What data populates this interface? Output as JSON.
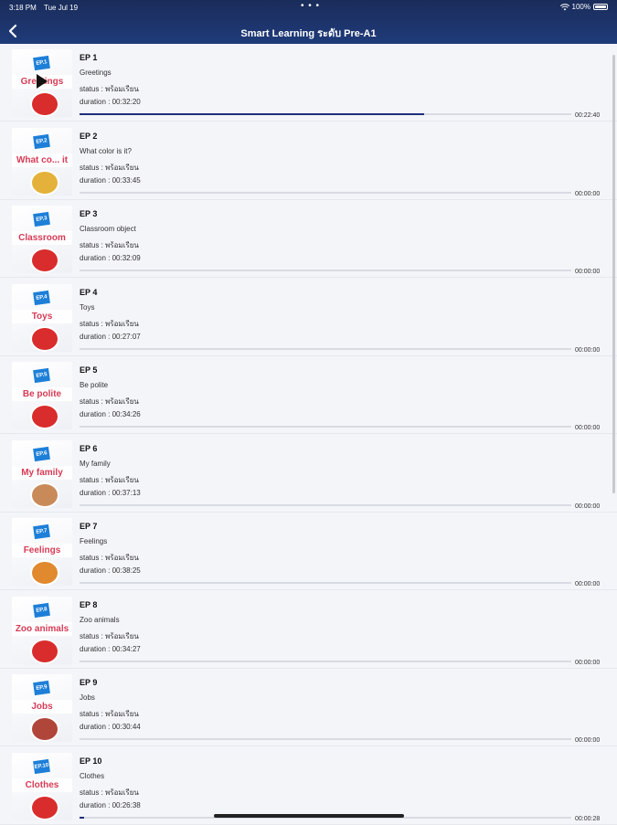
{
  "statusbar": {
    "time": "3:18 PM",
    "date": "Tue Jul 19",
    "dots": "• • •",
    "battery": "100%"
  },
  "header": {
    "title": "Smart Learning ระดับ Pre-A1"
  },
  "episodes": [
    {
      "ep": "EP 1",
      "tag": "EP.1",
      "name": "Greetings",
      "thumb_word": "Greetings",
      "status": "status : พร้อมเรียน",
      "duration": "duration :   00:32:20",
      "watched": "00:22:40",
      "progress": 0.7,
      "playing": true,
      "circle": "#d92c2c"
    },
    {
      "ep": "EP 2",
      "tag": "EP.2",
      "name": "What color is it?",
      "thumb_word": "What co... it",
      "status": "status : พร้อมเรียน",
      "duration": "duration :   00:33:45",
      "watched": "00:00:00",
      "progress": 0.0,
      "playing": false,
      "circle": "#e4b23a"
    },
    {
      "ep": "EP 3",
      "tag": "EP.3",
      "name": "Classroom object",
      "thumb_word": "Classroom",
      "status": "status : พร้อมเรียน",
      "duration": "duration :   00:32:09",
      "watched": "00:00:00",
      "progress": 0.0,
      "playing": false,
      "circle": "#d92c2c"
    },
    {
      "ep": "EP 4",
      "tag": "EP.4",
      "name": "Toys",
      "thumb_word": "Toys",
      "status": "status : พร้อมเรียน",
      "duration": "duration :   00:27:07",
      "watched": "00:00:00",
      "progress": 0.0,
      "playing": false,
      "circle": "#d92c2c"
    },
    {
      "ep": "EP 5",
      "tag": "EP.5",
      "name": "Be polite",
      "thumb_word": "Be polite",
      "status": "status : พร้อมเรียน",
      "duration": "duration :   00:34:26",
      "watched": "00:00:00",
      "progress": 0.0,
      "playing": false,
      "circle": "#d92c2c"
    },
    {
      "ep": "EP 6",
      "tag": "EP.6",
      "name": "My family",
      "thumb_word": "My family",
      "status": "status : พร้อมเรียน",
      "duration": "duration :   00:37:13",
      "watched": "00:00:00",
      "progress": 0.0,
      "playing": false,
      "circle": "#c98a5a"
    },
    {
      "ep": "EP 7",
      "tag": "EP.7",
      "name": "Feelings",
      "thumb_word": "Feelings",
      "status": "status : พร้อมเรียน",
      "duration": "duration :   00:38:25",
      "watched": "00:00:00",
      "progress": 0.0,
      "playing": false,
      "circle": "#e0892e"
    },
    {
      "ep": "EP 8",
      "tag": "EP.8",
      "name": "Zoo animals",
      "thumb_word": "Zoo animals",
      "status": "status : พร้อมเรียน",
      "duration": "duration :   00:34:27",
      "watched": "00:00:00",
      "progress": 0.0,
      "playing": false,
      "circle": "#d92c2c"
    },
    {
      "ep": "EP 9",
      "tag": "EP.9",
      "name": "Jobs",
      "thumb_word": "Jobs",
      "status": "status : พร้อมเรียน",
      "duration": "duration :   00:30:44",
      "watched": "00:00:00",
      "progress": 0.0,
      "playing": false,
      "circle": "#b0463a"
    },
    {
      "ep": "EP 10",
      "tag": "EP.10",
      "name": "Clothes",
      "thumb_word": "Clothes",
      "status": "status : พร้อมเรียน",
      "duration": "duration :   00:26:38",
      "watched": "00:00:28",
      "progress": 0.01,
      "playing": false,
      "circle": "#d92c2c"
    }
  ]
}
